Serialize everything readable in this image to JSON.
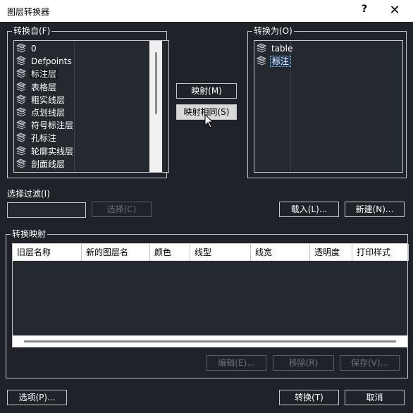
{
  "window": {
    "title": "图层转换器",
    "help_label": "?",
    "close_label": "✕"
  },
  "convert_from": {
    "label": "转换自(F)",
    "items": [
      {
        "name": "0",
        "selected": false
      },
      {
        "name": "Defpoints",
        "selected": false
      },
      {
        "name": "标注层",
        "selected": true
      },
      {
        "name": "表格层",
        "selected": false
      },
      {
        "name": "粗实线层",
        "selected": false
      },
      {
        "name": "点划线层",
        "selected": false
      },
      {
        "name": "符号标注层",
        "selected": false
      },
      {
        "name": "孔标注",
        "selected": false
      },
      {
        "name": "轮廓实线层",
        "selected": false
      },
      {
        "name": "剖面线层",
        "selected": false
      }
    ]
  },
  "convert_to": {
    "label": "转换为(O)",
    "items": [
      {
        "name": "table",
        "selected": false
      },
      {
        "name": "标注",
        "selected": true
      }
    ]
  },
  "buttons": {
    "map": "映射(M)",
    "map_same": "映射相同(S)",
    "select": "选择(C)",
    "load": "载入(L)...",
    "new": "新建(N)...",
    "edit": "编辑(E)...",
    "remove": "移除(R)",
    "save": "保存(V)...",
    "options": "选项(P)...",
    "convert": "转换(T)",
    "cancel": "取消"
  },
  "filter": {
    "label": "选择过滤(I)",
    "value": ""
  },
  "mapping": {
    "label": "转换映射",
    "columns": [
      "旧层名称",
      "新的图层名",
      "颜色",
      "线型",
      "线宽",
      "透明度",
      "打印样式"
    ],
    "rows": []
  },
  "colors": {
    "background": "#1f2228",
    "list_bg": "#242930",
    "selection": "#1f3c5e"
  },
  "icons": {
    "layer": "layer-stack-icon",
    "help": "help-icon",
    "close": "close-icon",
    "cursor": "mouse-pointer-icon"
  }
}
